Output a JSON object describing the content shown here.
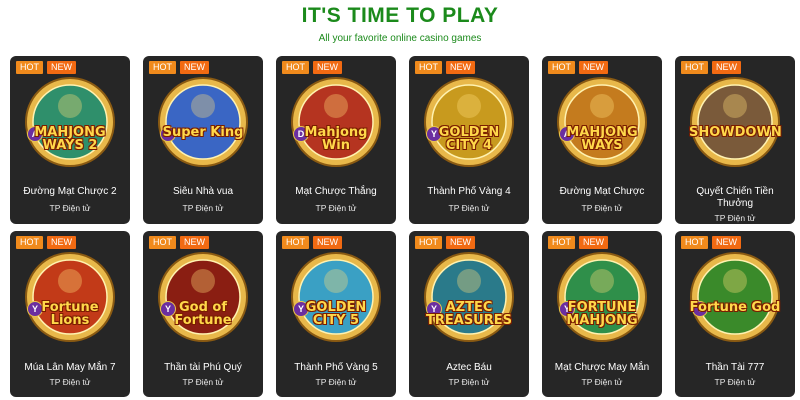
{
  "header": {
    "title": "IT'S TIME TO PLAY",
    "subtitle": "All your favorite online casino games"
  },
  "badges": {
    "hot": "HOT",
    "new": "NEW"
  },
  "colors": {
    "title": "#1b8a1b",
    "card_bg": "#262626",
    "badge_hot": "#f08a1c",
    "badge_new": "#f26a12",
    "gold": "#e8b84a"
  },
  "games": [
    {
      "name": "Đường Mạt Chược 2",
      "provider": "TP Điện tử",
      "art_text": "MAHJONG WAYS 2",
      "chip": "A",
      "icon": "mahjong-ways-2-icon",
      "bg": "#2f8f6b"
    },
    {
      "name": "Siêu Nhà vua",
      "provider": "TP Điện tử",
      "art_text": "Super King",
      "chip": "T",
      "icon": "super-king-icon",
      "bg": "#3a66c4"
    },
    {
      "name": "Mạt Chược Thắng",
      "provider": "TP Điện tử",
      "art_text": "Mahjong Win",
      "chip": "D",
      "icon": "mahjong-win-icon",
      "bg": "#b53420"
    },
    {
      "name": "Thành Phố Vàng 4",
      "provider": "TP Điện tử",
      "art_text": "GOLDEN CITY 4",
      "chip": "Y",
      "icon": "golden-city-4-icon",
      "bg": "#c89a1e"
    },
    {
      "name": "Đường Mạt Chược",
      "provider": "TP Điện tử",
      "art_text": "MAHJONG WAYS",
      "chip": "A",
      "icon": "mahjong-ways-icon",
      "bg": "#c47b1e"
    },
    {
      "name": "Quyết Chiến Tiền Thưởng",
      "provider": "TP Điện tử",
      "art_text": "SHOWDOWN",
      "chip": "",
      "icon": "bounty-showdown-icon",
      "bg": "#7a5a3a"
    },
    {
      "name": "Múa Lân May Mắn 7",
      "provider": "TP Điện tử",
      "art_text": "Fortune Lions",
      "chip": "Y",
      "icon": "fortune-lions-icon",
      "bg": "#c23a18"
    },
    {
      "name": "Thần tài Phú Quý",
      "provider": "TP Điện tử",
      "art_text": "God of Fortune",
      "chip": "Y",
      "icon": "god-of-fortune-icon",
      "bg": "#8a1e12"
    },
    {
      "name": "Thành Phố Vàng 5",
      "provider": "TP Điện tử",
      "art_text": "GOLDEN CITY 5",
      "chip": "Y",
      "icon": "golden-city-5-icon",
      "bg": "#3aa0c4"
    },
    {
      "name": "Aztec Báu",
      "provider": "TP Điện tử",
      "art_text": "AZTEC TREASURES",
      "chip": "Y",
      "icon": "aztec-treasures-icon",
      "bg": "#2a7a8a"
    },
    {
      "name": "Mạt Chược May Mắn",
      "provider": "TP Điện tử",
      "art_text": "FORTUNE MAHJONG",
      "chip": "Y",
      "icon": "fortune-mahjong-icon",
      "bg": "#2f8f4a"
    },
    {
      "name": "Thần Tài 777",
      "provider": "TP Điện tử",
      "art_text": "Fortune God",
      "chip": "Y",
      "icon": "fortune-god-icon",
      "bg": "#3a8a2a"
    }
  ]
}
